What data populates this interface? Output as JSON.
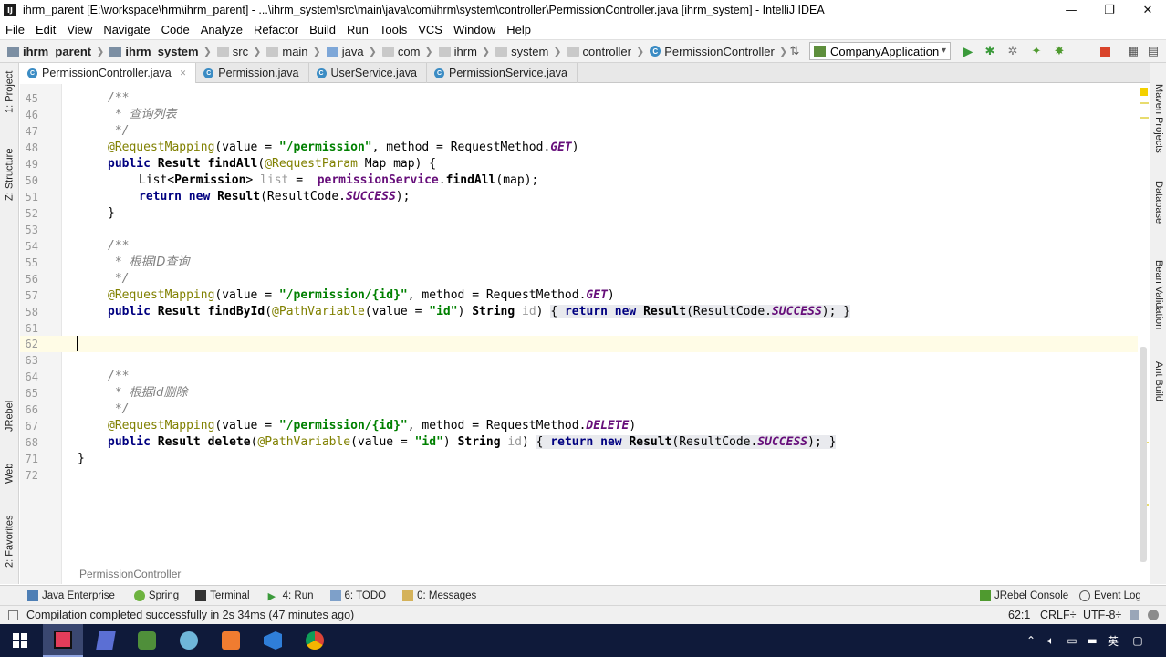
{
  "window": {
    "title": "ihrm_parent [E:\\workspace\\hrm\\ihrm_parent] - ...\\ihrm_system\\src\\main\\java\\com\\ihrm\\system\\controller\\PermissionController.java [ihrm_system] - IntelliJ IDEA",
    "app_icon": "IJ",
    "minimize": "—",
    "maximize": "❐",
    "close": "✕"
  },
  "menu": [
    "File",
    "Edit",
    "View",
    "Navigate",
    "Code",
    "Analyze",
    "Refactor",
    "Build",
    "Run",
    "Tools",
    "VCS",
    "Window",
    "Help"
  ],
  "navbar": {
    "crumbs": [
      "ihrm_parent",
      "ihrm_system",
      "src",
      "main",
      "java",
      "com",
      "ihrm",
      "system",
      "controller",
      "PermissionController"
    ],
    "run_config": "CompanyApplication"
  },
  "left_tools": [
    "1: Project",
    "Z: Structure",
    "JRebel",
    "Web",
    "2: Favorites"
  ],
  "right_tools": [
    "Maven Projects",
    "Database",
    "Bean Validation",
    "Ant Build"
  ],
  "tabs": [
    {
      "label": "PermissionController.java",
      "active": true,
      "icon": "class-icon"
    },
    {
      "label": "Permission.java",
      "active": false,
      "icon": "class-icon"
    },
    {
      "label": "UserService.java",
      "active": false,
      "icon": "class-icon"
    },
    {
      "label": "PermissionService.java",
      "active": false,
      "icon": "class-icon"
    }
  ],
  "editor": {
    "line_numbers": [
      "45",
      "46",
      "47",
      "48",
      "49",
      "50",
      "51",
      "52",
      "53",
      "54",
      "55",
      "56",
      "57",
      "58",
      "61",
      "62",
      "63",
      "64",
      "65",
      "66",
      "67",
      "68",
      "71",
      "72"
    ],
    "comment_find_all": "查询列表",
    "comment_find_by_id": "根据ID查询",
    "comment_delete": "根据id删除",
    "url_permission": "\"/permission\"",
    "url_permission_id": "\"/permission/{id}\"",
    "id_literal": "\"id\"",
    "bottom_breadcrumb": "PermissionController"
  },
  "tool_windows": [
    "Java Enterprise",
    "Spring",
    "Terminal",
    "4: Run",
    "6: TODO",
    "0: Messages",
    "JRebel Console",
    "Event Log"
  ],
  "status": {
    "message": "Compilation completed successfully in 2s 34ms (47 minutes ago)",
    "position": "62:1",
    "line_sep": "CRLF÷",
    "encoding": "UTF-8÷"
  },
  "tray": {
    "ime": "英"
  },
  "colors": {
    "keyword": "#000080",
    "annotation": "#808000",
    "string": "#008000",
    "comment": "#808080",
    "constant": "#660e7a",
    "taskbar": "#0f1a3a"
  }
}
